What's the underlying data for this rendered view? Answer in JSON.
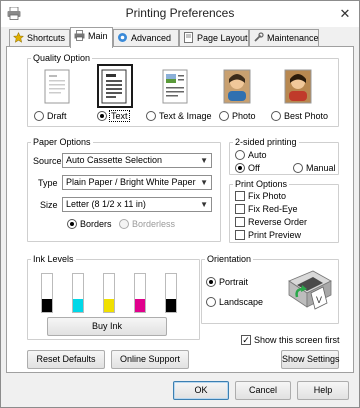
{
  "window": {
    "title": "Printing Preferences"
  },
  "tabs": [
    {
      "label": "Shortcuts"
    },
    {
      "label": "Main"
    },
    {
      "label": "Advanced"
    },
    {
      "label": "Page Layout"
    },
    {
      "label": "Maintenance"
    }
  ],
  "active_tab": "Main",
  "quality": {
    "legend": "Quality Option",
    "options": [
      "Draft",
      "Text",
      "Text & Image",
      "Photo",
      "Best Photo"
    ],
    "selected": "Text"
  },
  "paper": {
    "legend": "Paper Options",
    "source_label": "Source",
    "source_value": "Auto Cassette Selection",
    "type_label": "Type",
    "type_value": "Plain Paper / Bright White Paper",
    "size_label": "Size",
    "size_value": "Letter (8 1/2 x 11 in)",
    "borders_label": "Borders",
    "borderless_label": "Borderless",
    "border_selected": "Borders"
  },
  "two_sided": {
    "legend": "2-sided printing",
    "auto_label": "Auto",
    "off_label": "Off",
    "manual_label": "Manual",
    "selected": "Off"
  },
  "print_options": {
    "legend": "Print Options",
    "items": [
      {
        "label": "Fix Photo",
        "checked": false
      },
      {
        "label": "Fix Red-Eye",
        "checked": false
      },
      {
        "label": "Reverse Order",
        "checked": false
      },
      {
        "label": "Print Preview",
        "checked": false
      }
    ]
  },
  "ink": {
    "legend": "Ink Levels",
    "cartridges": [
      {
        "color": "#000000",
        "level": 0.35
      },
      {
        "color": "#00d8e8",
        "level": 0.35
      },
      {
        "color": "#f0e000",
        "level": 0.35
      },
      {
        "color": "#e0008c",
        "level": 0.35
      },
      {
        "color": "#000000",
        "level": 0.35
      }
    ],
    "buy_label": "Buy Ink"
  },
  "orientation": {
    "legend": "Orientation",
    "portrait_label": "Portrait",
    "landscape_label": "Landscape",
    "selected": "Portrait"
  },
  "show_screen_first": {
    "label": "Show this screen first",
    "checked": true
  },
  "buttons": {
    "reset_defaults": "Reset Defaults",
    "online_support": "Online Support",
    "show_settings": "Show Settings",
    "ok": "OK",
    "cancel": "Cancel",
    "help": "Help"
  }
}
